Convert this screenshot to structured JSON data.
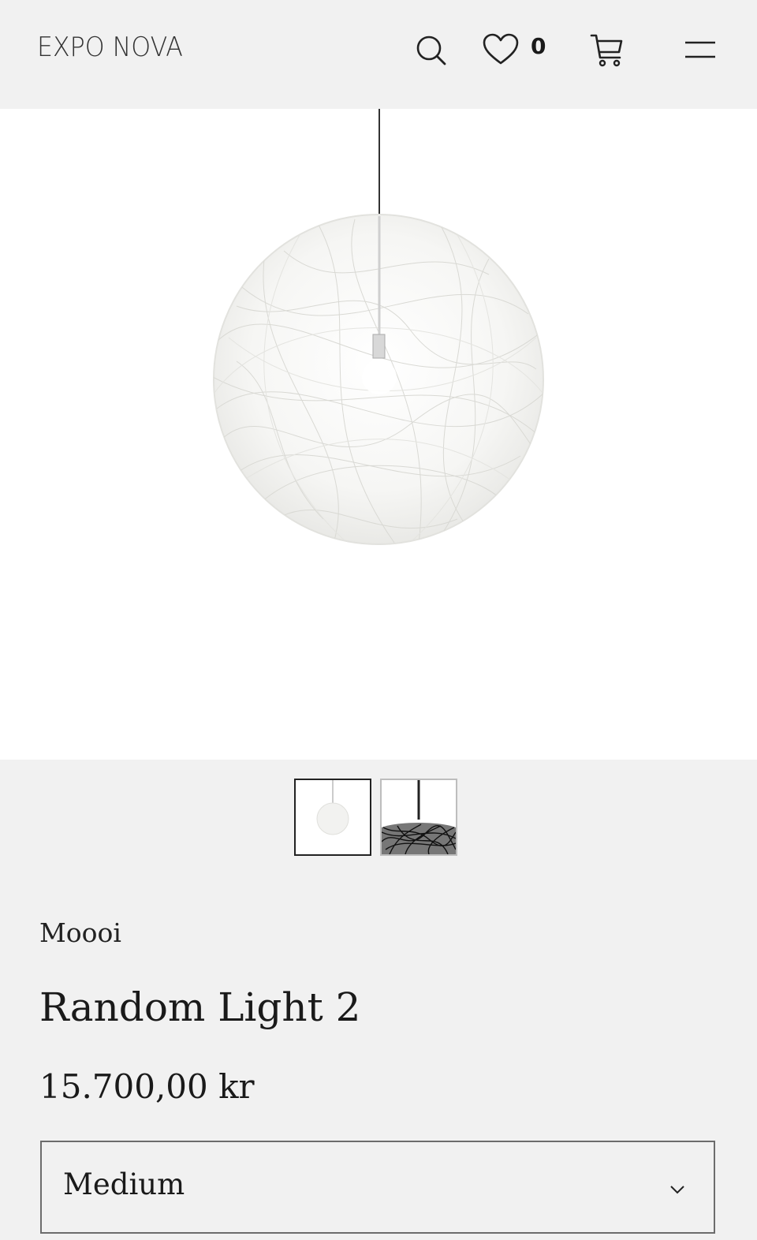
{
  "header": {
    "logo": "EXPO NOVA",
    "search_icon": "search-icon",
    "wishlist_icon": "heart-icon",
    "wishlist_count": "0",
    "cart_icon": "cart-icon",
    "menu_icon": "hamburger-menu-icon"
  },
  "product": {
    "brand": "Moooi",
    "name": "Random Light 2",
    "price": "15.700,00 kr",
    "size_select": {
      "value": "Medium",
      "icon": "chevron-down-icon"
    },
    "gallery": {
      "main_image": "white-random-pendant-lamp",
      "thumbnails": [
        "white-random-pendant-lamp",
        "black-random-pendant-detail"
      ],
      "active_thumbnail": 0
    }
  },
  "colors": {
    "background": "#f1f1f1",
    "image_background": "#ffffff",
    "text": "#1a1a1a"
  }
}
